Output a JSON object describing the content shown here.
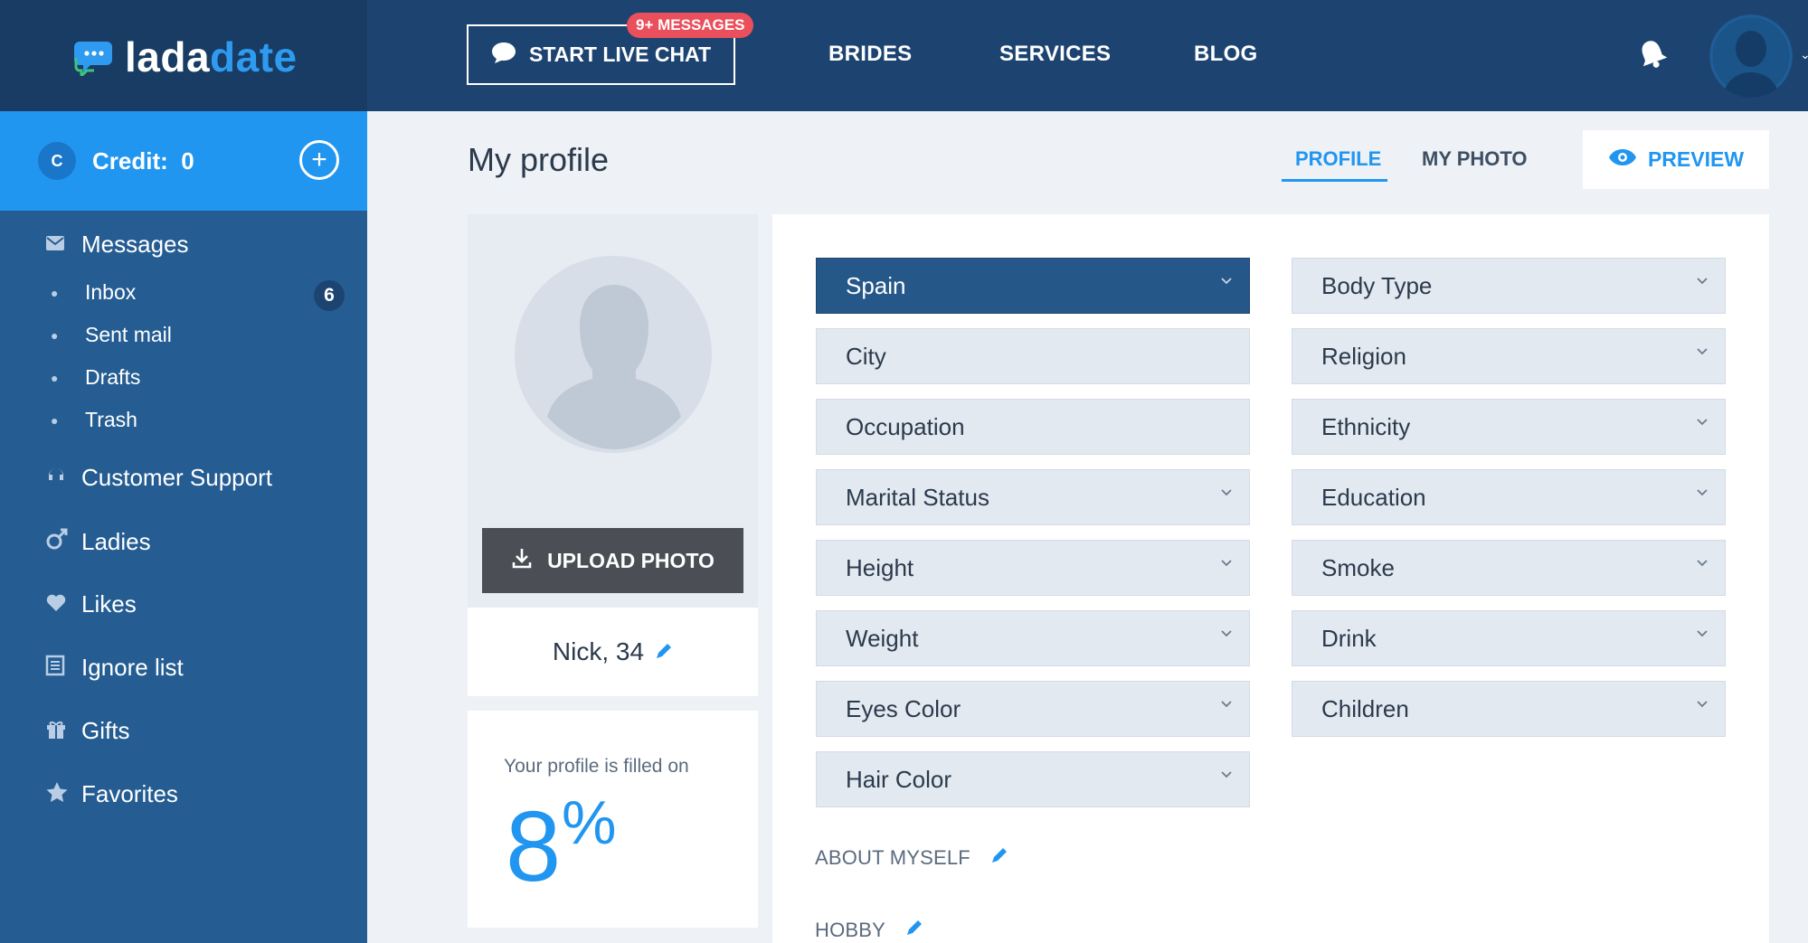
{
  "header": {
    "logo_part1": "lada",
    "logo_part2": "date",
    "live_chat_label": "START LIVE CHAT",
    "messages_badge": "9+ MESSAGES",
    "nav": [
      "BRIDES",
      "SERVICES",
      "BLOG"
    ],
    "icons": {
      "notifications": "bell-icon",
      "profile": "avatar-icon",
      "chat": "chat-bubble-icon"
    }
  },
  "sidebar": {
    "credit_icon": "C",
    "credit_label": "Credit:",
    "credit_value": "0",
    "add_credit_icon": "+",
    "messages_label": "Messages",
    "sub_items": [
      {
        "label": "Inbox"
      },
      {
        "label": "Sent mail"
      },
      {
        "label": "Drafts"
      },
      {
        "label": "Trash"
      }
    ],
    "inbox_count": "6",
    "items": [
      {
        "label": "Customer Support",
        "icon": "support-icon"
      },
      {
        "label": "Ladies",
        "icon": "gender-icon"
      },
      {
        "label": "Likes",
        "icon": "heart-icon"
      },
      {
        "label": "Ignore list",
        "icon": "list-icon"
      },
      {
        "label": "Gifts",
        "icon": "gift-icon"
      },
      {
        "label": "Favorites",
        "icon": "star-icon"
      }
    ]
  },
  "main": {
    "title": "My profile",
    "tabs": [
      "PROFILE",
      "MY PHOTO"
    ],
    "active_tab": "PROFILE",
    "preview_label": "PREVIEW",
    "upload_label": "UPLOAD PHOTO",
    "user_name": "Nick, 34",
    "fill_label": "Your profile is filled on",
    "fill_value": "8",
    "fill_unit": "%",
    "fields_left": [
      {
        "label": "Spain",
        "type": "select",
        "selected": true
      },
      {
        "label": "City",
        "type": "input"
      },
      {
        "label": "Occupation",
        "type": "input"
      },
      {
        "label": "Marital Status",
        "type": "select"
      },
      {
        "label": "Height",
        "type": "select"
      },
      {
        "label": "Weight",
        "type": "select"
      },
      {
        "label": "Eyes Color",
        "type": "select"
      },
      {
        "label": "Hair Color",
        "type": "select"
      }
    ],
    "fields_right": [
      {
        "label": "Body Type",
        "type": "select"
      },
      {
        "label": "Religion",
        "type": "select"
      },
      {
        "label": "Ethnicity",
        "type": "select"
      },
      {
        "label": "Education",
        "type": "select"
      },
      {
        "label": "Smoke",
        "type": "select"
      },
      {
        "label": "Drink",
        "type": "select"
      },
      {
        "label": "Children",
        "type": "select"
      }
    ],
    "about_label": "ABOUT MYSELF",
    "hobby_label": "HOBBY"
  },
  "colors": {
    "topbar": "#1d4470",
    "sidebar": "#255d93",
    "accent": "#2196f0",
    "badge": "#ea4f5c",
    "selected_field": "#265789"
  }
}
